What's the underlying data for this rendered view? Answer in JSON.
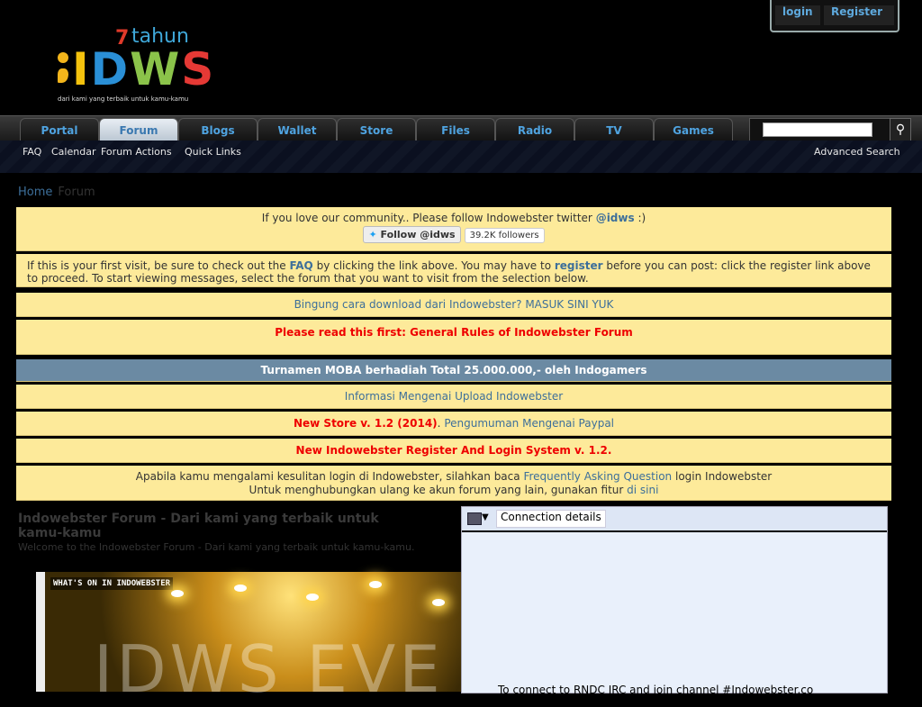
{
  "header": {
    "logo": {
      "year": "7",
      "tahun": "tahun",
      "brand": "IDWS",
      "tagline": "dari kami yang terbaik untuk kamu-kamu"
    },
    "auth": {
      "login": "login",
      "register": "Register"
    }
  },
  "nav": {
    "tabs": [
      "Portal",
      "Forum",
      "Blogs",
      "Wallet",
      "Store",
      "Files",
      "Radio",
      "TV",
      "Games"
    ],
    "active_tab": "Forum",
    "search_placeholder": ""
  },
  "subnav": {
    "items": [
      "FAQ",
      "Calendar",
      "Forum Actions",
      "Quick Links"
    ],
    "advanced_search": "Advanced Search"
  },
  "breadcrumb": {
    "home": "Home",
    "current": "Forum"
  },
  "notices": {
    "twitter": {
      "text": "If you love our community.. Please follow Indowebster twitter",
      "handle": "@idws",
      "suffix": ":)",
      "follow_btn": "Follow @idws",
      "followers": "39.2K followers"
    },
    "first_visit": {
      "p1": "If this is your first visit, be sure to check out the",
      "faq": "FAQ",
      "p2": "by clicking the link above. You may have to",
      "register": "register",
      "p3": "before you can post: click the register link above to proceed. To start viewing messages, select the forum that you want to visit from the selection below."
    },
    "download": "Bingung cara download dari Indowebster? MASUK SINI YUK",
    "rules": "Please read this first: General Rules of Indowebster Forum",
    "tournament": "Turnamen MOBA berhadiah Total 25.000.000,- oleh Indogamers",
    "upload": "Informasi Mengenai Upload Indowebster",
    "store": {
      "red": "New Store v. 1.2 (2014)",
      "sep": ".",
      "link": "Pengumuman Mengenai Paypal"
    },
    "register_system": "New Indowebster Register And Login System v. 1.2.",
    "login_help": {
      "p1": "Apabila kamu mengalami kesulitan login di Indowebster, silahkan baca",
      "link1": "Frequently Asking Question",
      "p2": "login Indowebster",
      "p3": "Untuk menghubungkan ulang ke akun forum yang lain, gunakan fitur",
      "link2": "di sini"
    }
  },
  "forum": {
    "title": "Indowebster Forum - Dari kami yang terbaik untuk kamu-kamu",
    "subtitle": "Welcome to the Indowebster Forum - Dari kami yang terbaik untuk kamu-kamu."
  },
  "banner": {
    "tag": "WHAT'S ON IN INDOWEBSTER",
    "text": "IDWS EVE"
  },
  "irc": {
    "button": "Connection details",
    "text": "To connect to RNDC IRC and join channel #Indowebster.co"
  },
  "colors": {
    "notice_bg": "#fdea9a",
    "link": "#3d6f9a",
    "alert_red": "#ee0000",
    "tournament_bg": "#6b8aa3"
  }
}
